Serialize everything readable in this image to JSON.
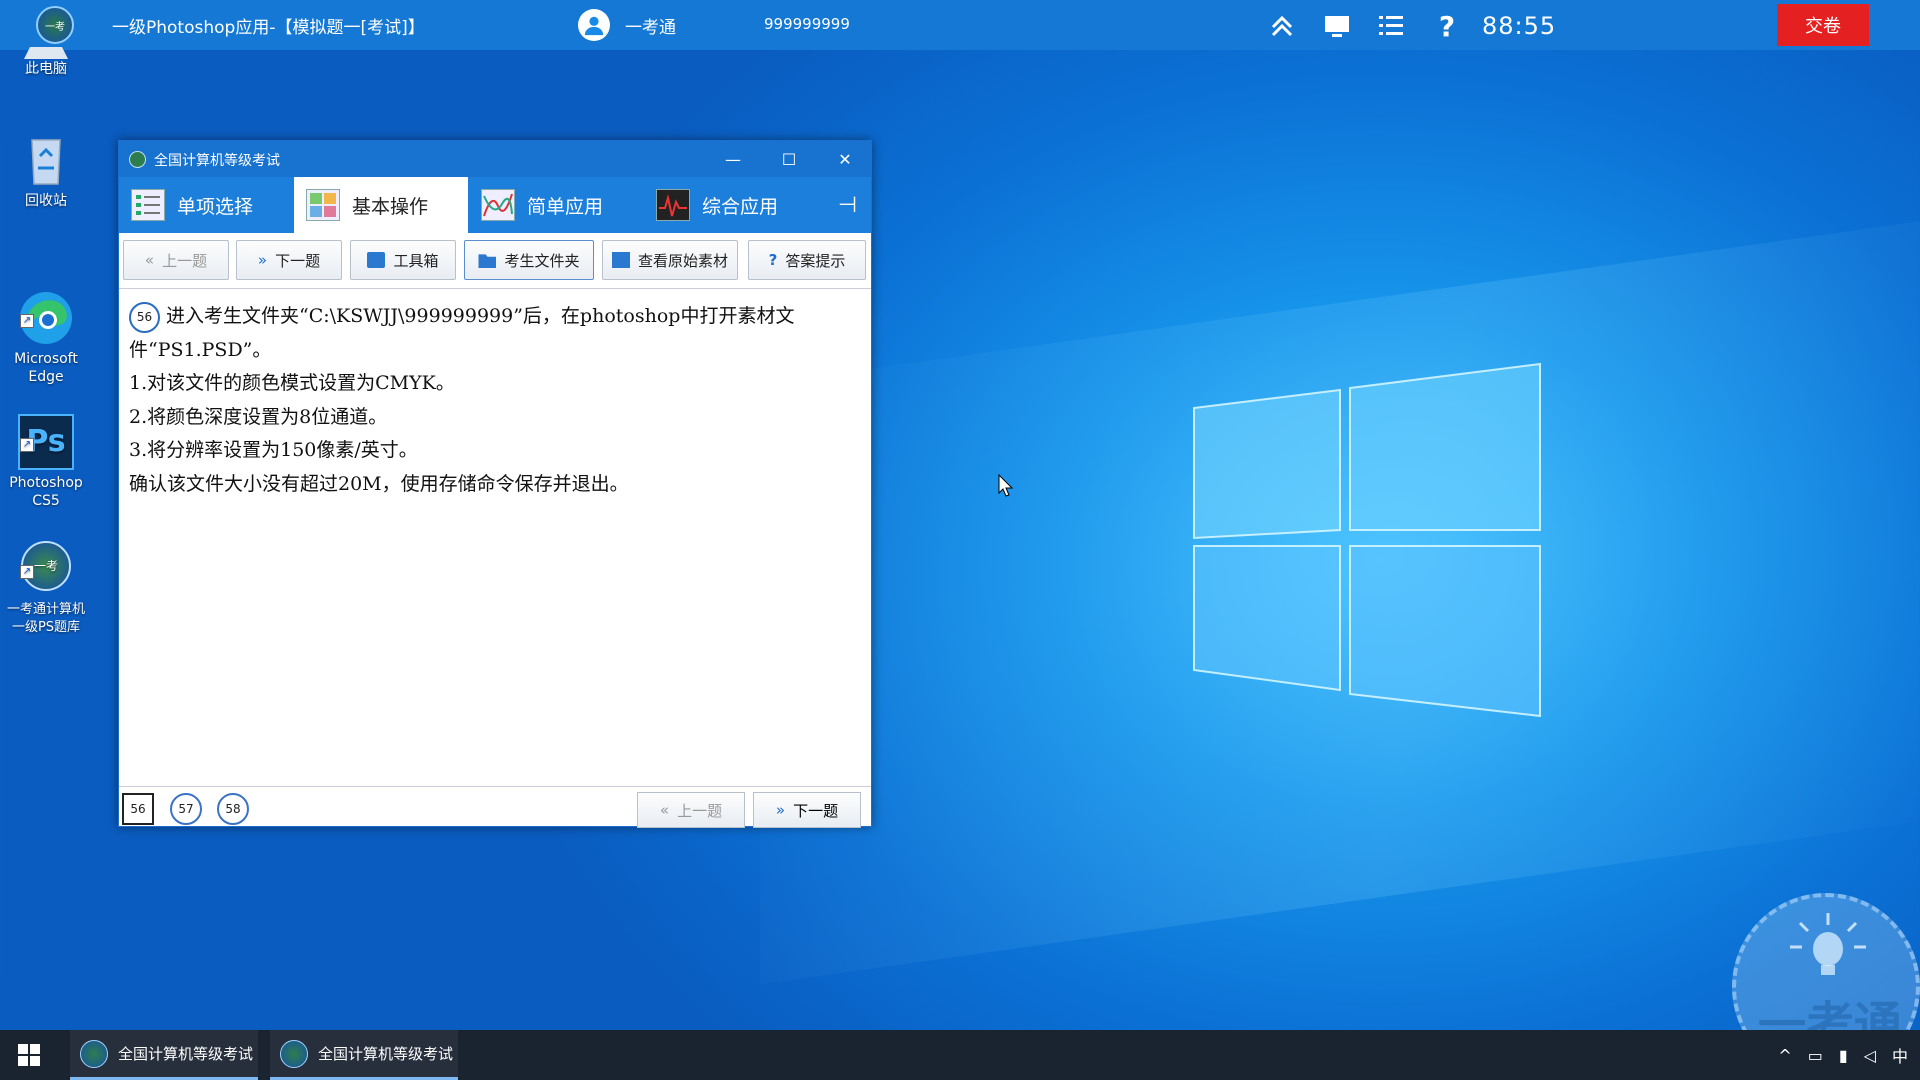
{
  "colors": {
    "topbar": "#1478d4",
    "submit": "#e52020",
    "tab_bar": "#1c7fdc",
    "taskbar": "#1a2330"
  },
  "topbar": {
    "title": "一级Photoshop应用-【模拟题一[考试]】",
    "username": "一考通",
    "user_id": "999999999",
    "timer": "88:55",
    "submit_label": "交卷",
    "icons": [
      "double-chevron-up-icon",
      "monitor-icon",
      "list-icon",
      "help-icon"
    ]
  },
  "desktop": {
    "icons": [
      {
        "label": "此电脑",
        "icon": "computer-icon"
      },
      {
        "label": "回收站",
        "icon": "recycle-bin-icon"
      },
      {
        "label": "Microsoft\nEdge",
        "icon": "edge-icon"
      },
      {
        "label": "Photoshop\nCS5",
        "icon": "photoshop-icon"
      },
      {
        "label": "一考通计算机\n一级PS题库",
        "icon": "yikaotong-icon"
      }
    ]
  },
  "window": {
    "title": "全国计算机等级考试",
    "tabs": [
      {
        "label": "单项选择"
      },
      {
        "label": "基本操作",
        "active": true
      },
      {
        "label": "简单应用"
      },
      {
        "label": "综合应用"
      }
    ],
    "toolbar": {
      "prev": "上一题",
      "next": "下一题",
      "toolbox": "工具箱",
      "student_folder": "考生文件夹",
      "view_material": "查看原始素材",
      "answer_hint": "答案提示"
    },
    "question": {
      "number": "56",
      "line1": "进入考生文件夹“C:\\KSWJJ\\999999999”后，在photoshop中打开素材文",
      "line2": "件“PS1.PSD”。",
      "line3": "1.对该文件的颜色模式设置为CMYK。",
      "line4": "2.将颜色深度设置为8位通道。",
      "line5": "3.将分辨率设置为150像素/英寸。",
      "line6": "确认该文件大小没有超过20M，使用存储命令保存并退出。"
    },
    "pager": [
      "56",
      "57",
      "58"
    ],
    "bottom": {
      "prev": "上一题",
      "next": "下一题"
    }
  },
  "taskbar": {
    "tasks": [
      "全国计算机等级考试",
      "全国计算机等级考试"
    ],
    "ime": "中"
  },
  "watermark": {
    "text": "一考通"
  }
}
